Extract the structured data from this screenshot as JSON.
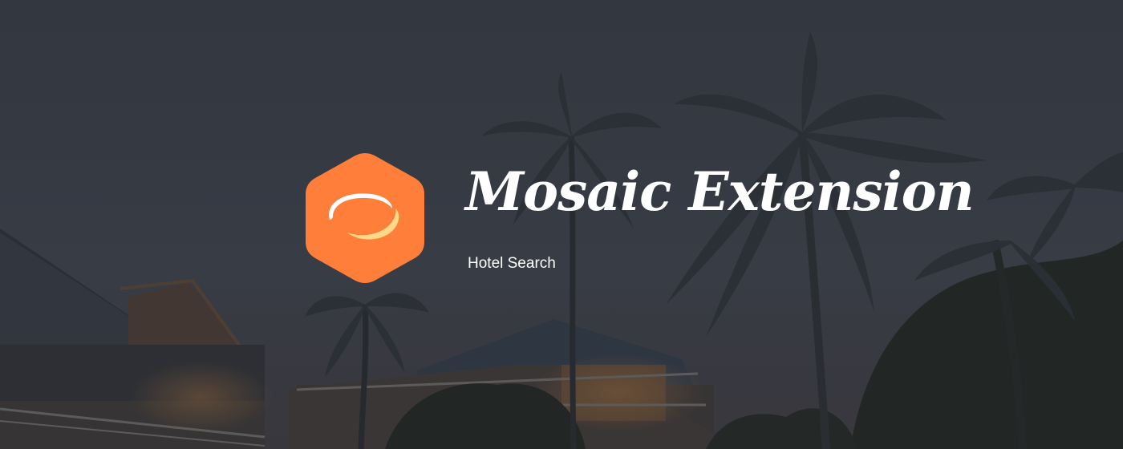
{
  "brand": {
    "title": "Mosaic Extension",
    "subtitle": "Hotel Search",
    "logo_icon": "orange-hexagon-ring-logo"
  },
  "colors": {
    "accent": "#ff7f3a",
    "ring_highlight": "#ffd88a",
    "text": "#ffffff",
    "sky": "#3a3e46",
    "foliage": "#1f2420",
    "building_roof": "#2b3340",
    "warm_light": "#8a5a33"
  },
  "background": {
    "scene": "dusk-hotel-with-palm-trees"
  }
}
